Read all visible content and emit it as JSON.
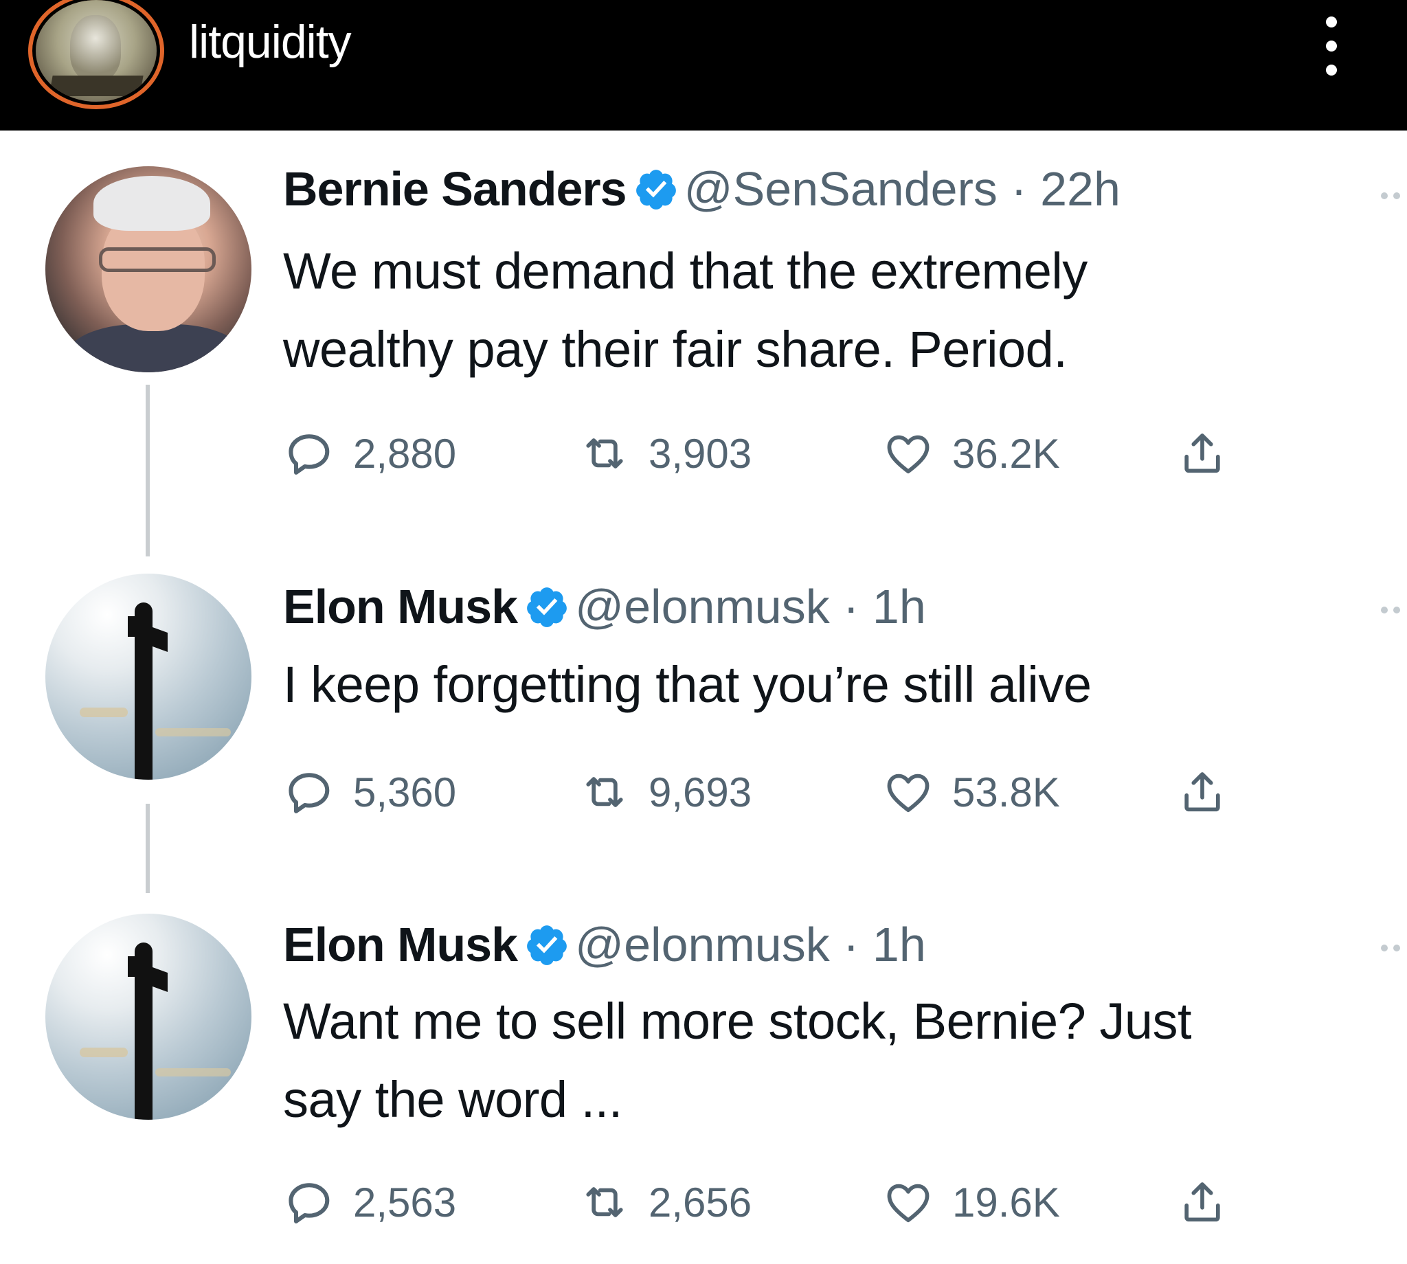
{
  "top_bar": {
    "account_name": "litquidity",
    "avatar_icon": "coin-avatar",
    "menu_icon": "more-vertical-icon"
  },
  "colors": {
    "top_bar_background": "#000000",
    "avatar_ring": "#e0652a",
    "verified_blue": "#1d9bf0",
    "text_primary": "#0f1419",
    "text_secondary": "#536471",
    "thread_line": "#c9cdd0"
  },
  "tweets": [
    {
      "name": "Bernie Sanders",
      "handle": "@SenSanders",
      "separator": "·",
      "time": "22h",
      "text_lines": [
        "We must demand that the extremely",
        "wealthy pay their fair share. Period."
      ],
      "replies": "2,880",
      "retweets": "3,903",
      "likes": "36.2K",
      "avatar_icon": "bernie-sanders-avatar"
    },
    {
      "name": "Elon Musk",
      "handle": "@elonmusk",
      "separator": "·",
      "time": "1h",
      "text_lines": [
        "I keep forgetting that you’re still alive"
      ],
      "replies": "5,360",
      "retweets": "9,693",
      "likes": "53.8K",
      "avatar_icon": "starship-rocket-avatar"
    },
    {
      "name": "Elon Musk",
      "handle": "@elonmusk",
      "separator": "·",
      "time": "1h",
      "text_lines": [
        "Want me to sell more stock, Bernie? Just",
        "say the word ..."
      ],
      "replies": "2,563",
      "retweets": "2,656",
      "likes": "19.6K",
      "avatar_icon": "starship-rocket-avatar"
    }
  ],
  "icons": {
    "reply": "reply-icon",
    "retweet": "retweet-icon",
    "like": "heart-icon",
    "share": "share-icon",
    "verified": "verified-badge-icon"
  }
}
